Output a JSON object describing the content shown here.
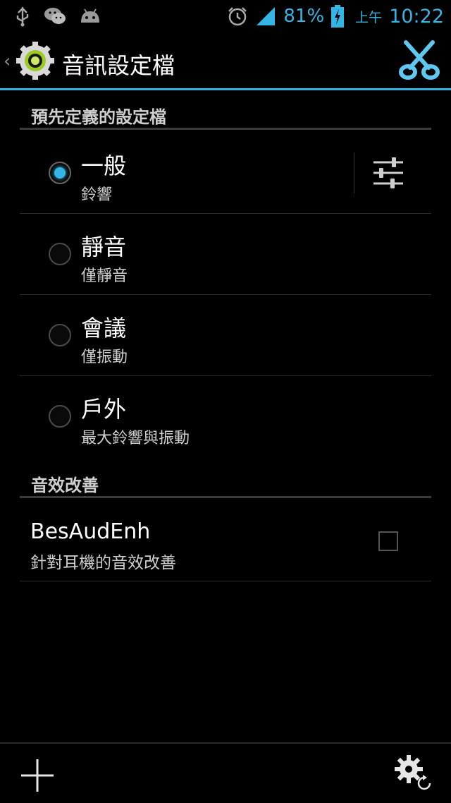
{
  "status_bar": {
    "icons_left": [
      "usb-icon",
      "wechat-icon",
      "android-icon"
    ],
    "icons_right": [
      "alarm-icon",
      "signal-icon",
      "battery-charging-icon"
    ],
    "battery_percent": "81%",
    "ampm": "上午",
    "time": "10:22",
    "accent": "#33b5e5"
  },
  "action_bar": {
    "title": "音訊設定檔",
    "back_glyph": "‹",
    "app_icon": "audio-profile-gear-icon",
    "action_icon": "scissors-icon"
  },
  "sections": {
    "predefined": {
      "header": "預先定義的設定檔",
      "profiles": [
        {
          "title": "一般",
          "summary": "鈴響",
          "selected": true
        },
        {
          "title": "靜音",
          "summary": "僅靜音",
          "selected": false
        },
        {
          "title": "會議",
          "summary": "僅振動",
          "selected": false
        },
        {
          "title": "戶外",
          "summary": "最大鈴響與振動",
          "selected": false
        }
      ]
    },
    "enhancement": {
      "header": "音效改善",
      "pref": {
        "title": "BesAudEnh",
        "summary": "針對耳機的音效改善",
        "checked": false
      }
    }
  },
  "bottom_bar": {
    "add_icon": "plus-icon",
    "settings_icon": "settings-reset-icon"
  }
}
